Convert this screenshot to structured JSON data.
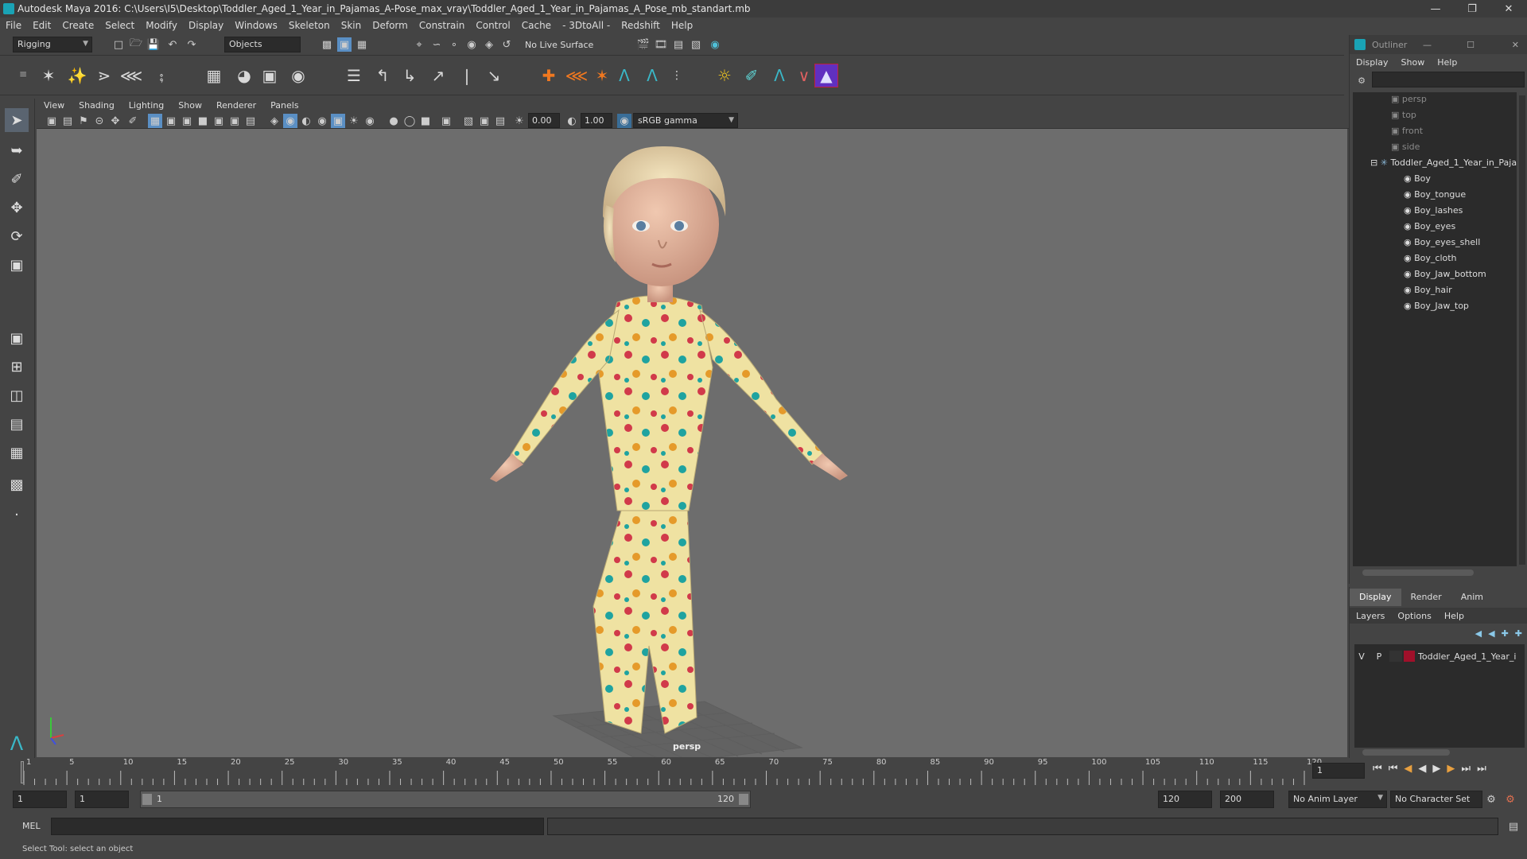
{
  "window": {
    "title": "Autodesk Maya 2016: C:\\Users\\I5\\Desktop\\Toddler_Aged_1_Year_in_Pajamas_A-Pose_max_vray\\Toddler_Aged_1_Year_in_Pajamas_A_Pose_mb_standart.mb"
  },
  "menu": [
    "File",
    "Edit",
    "Create",
    "Select",
    "Modify",
    "Display",
    "Windows",
    "Skeleton",
    "Skin",
    "Deform",
    "Constrain",
    "Control",
    "Cache",
    "- 3DtoAll -",
    "Redshift",
    "Help"
  ],
  "status": {
    "mode": "Rigging",
    "select_mode": "Objects",
    "live_surface": "No Live Surface"
  },
  "viewport": {
    "menu": [
      "View",
      "Shading",
      "Lighting",
      "Show",
      "Renderer",
      "Panels"
    ],
    "exposure": "0.00",
    "gamma": "1.00",
    "colorspace": "sRGB gamma",
    "camera_label": "persp"
  },
  "outliner": {
    "title": "Outliner",
    "menu": [
      "Display",
      "Show",
      "Help"
    ],
    "cameras": [
      "persp",
      "top",
      "front",
      "side"
    ],
    "group": "Toddler_Aged_1_Year_in_Paja",
    "children": [
      "Boy",
      "Boy_tongue",
      "Boy_lashes",
      "Boy_eyes",
      "Boy_eyes_shell",
      "Boy_cloth",
      "Boy_Jaw_bottom",
      "Boy_hair",
      "Boy_Jaw_top"
    ]
  },
  "layer_editor": {
    "tabs": [
      "Display",
      "Render",
      "Anim"
    ],
    "menu": [
      "Layers",
      "Options",
      "Help"
    ],
    "layer": {
      "v": "V",
      "p": "P",
      "name": "Toddler_Aged_1_Year_i",
      "color": "#a0102a"
    }
  },
  "timeline": {
    "ticks": [
      "1",
      "5",
      "10",
      "15",
      "20",
      "25",
      "30",
      "35",
      "40",
      "45",
      "50",
      "55",
      "60",
      "65",
      "70",
      "75",
      "80",
      "85",
      "90",
      "95",
      "100",
      "105",
      "110",
      "115",
      "120"
    ],
    "current": "1"
  },
  "range": {
    "start": "1",
    "playback_start": "1",
    "slider_start": "1",
    "slider_end": "120",
    "playback_end": "120",
    "end": "200",
    "anim_layer": "No Anim Layer",
    "char_set": "No Character Set"
  },
  "cmd": {
    "label": "MEL"
  },
  "help_line": "Select Tool: select an object",
  "colors": {
    "pajama": "#f0e2a0",
    "skin": "#e7b9a0",
    "hair": "#e8d5a8"
  }
}
